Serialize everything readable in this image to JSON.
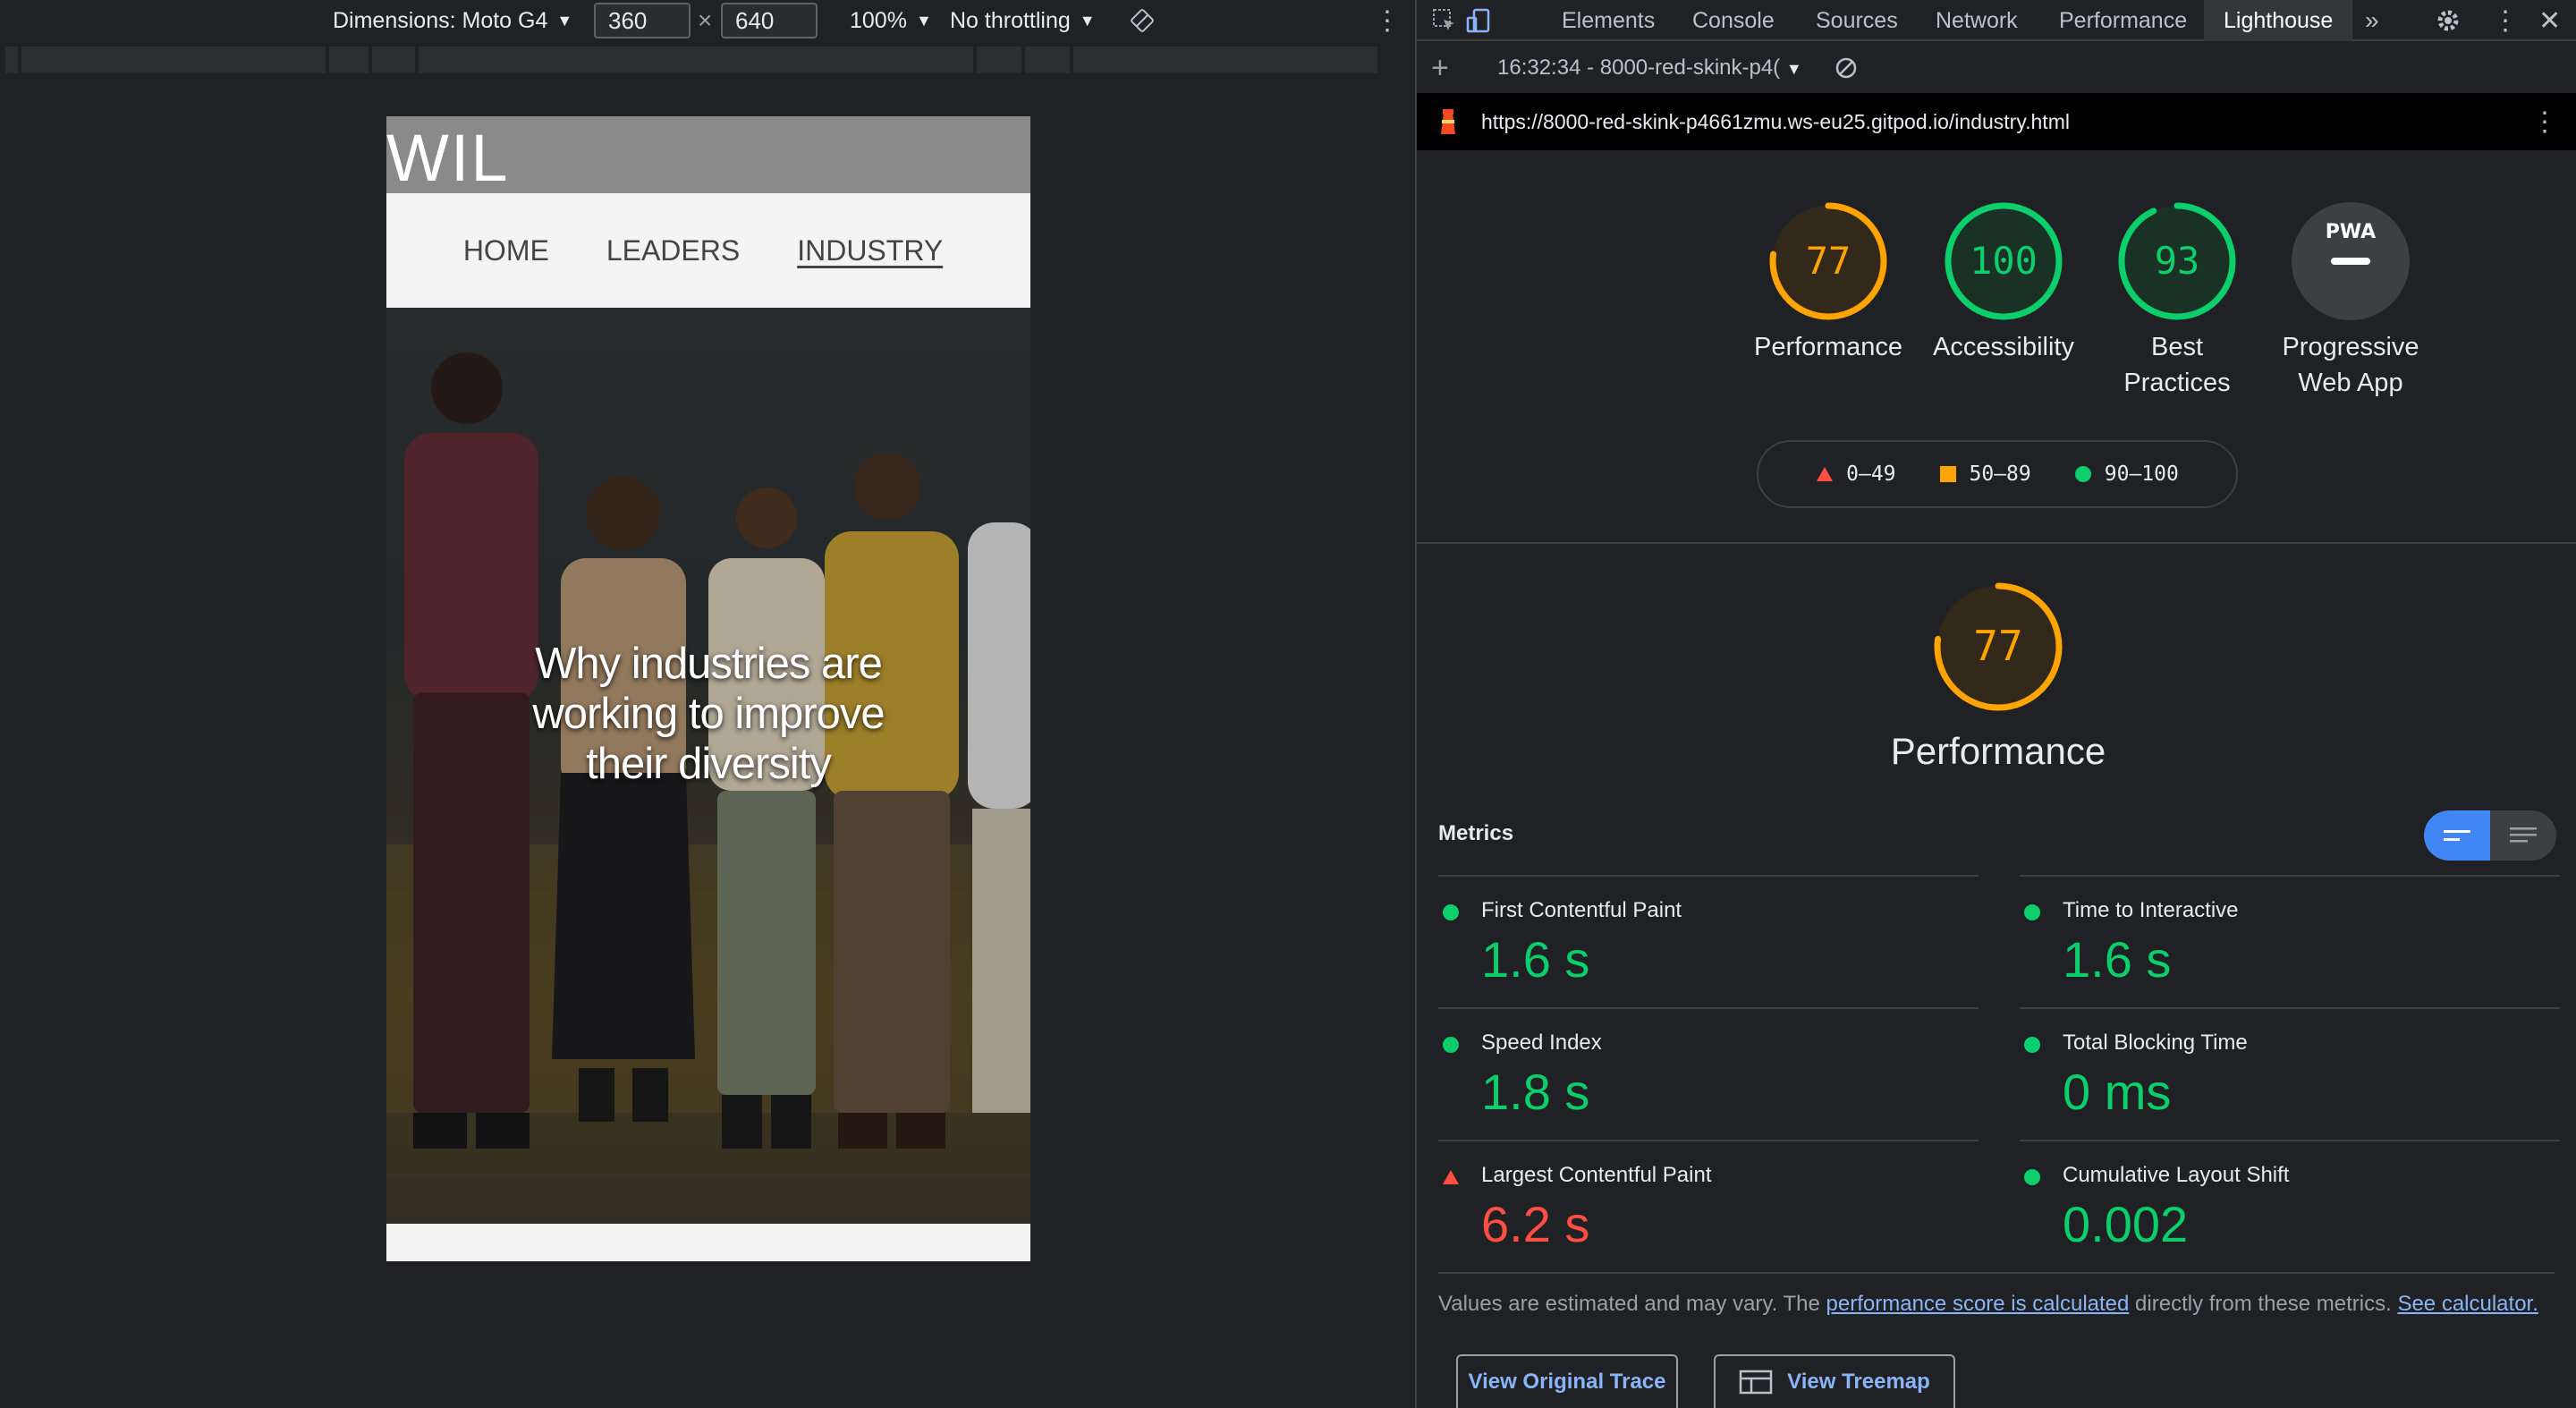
{
  "device_toolbar": {
    "dimensions_label": "Dimensions: Moto G4",
    "width_value": "360",
    "times": "×",
    "height_value": "640",
    "zoom": "100%",
    "throttling": "No throttling"
  },
  "site": {
    "logo": "WIL",
    "nav": [
      "HOME",
      "LEADERS",
      "INDUSTRY"
    ],
    "active_nav": "INDUSTRY",
    "hero_title": "Why industries are working to improve their diversity"
  },
  "devtools": {
    "tabs": [
      "Elements",
      "Console",
      "Sources",
      "Network",
      "Performance",
      "Lighthouse"
    ],
    "active_tab": "Lighthouse",
    "more_tabs": "»",
    "report_selector": "16:32:34 - 8000-red-skink-p4(",
    "url": "https://8000-red-skink-p4661zmu.ws-eu25.gitpod.io/industry.html"
  },
  "scores": [
    {
      "value": 77,
      "label": "Performance",
      "status": "average"
    },
    {
      "value": 100,
      "label": "Accessibility",
      "status": "pass"
    },
    {
      "value": 93,
      "label": "Best Practices",
      "label_line1": "Best",
      "label_line2": "Practices",
      "status": "pass"
    },
    {
      "value": null,
      "label": "Progressive Web App",
      "label_line1": "Progressive",
      "label_line2": "Web App",
      "badge": "PWA",
      "status": "na"
    }
  ],
  "legend": [
    {
      "range": "0–49",
      "shape": "triangle",
      "color": "#ff4e42"
    },
    {
      "range": "50–89",
      "shape": "square",
      "color": "#ffa400"
    },
    {
      "range": "90–100",
      "shape": "circle",
      "color": "#0cce6b"
    }
  ],
  "performance_section": {
    "score": "77",
    "title": "Performance",
    "metrics_title": "Metrics",
    "metrics": [
      {
        "name": "First Contentful Paint",
        "value": "1.6 s",
        "status": "pass"
      },
      {
        "name": "Time to Interactive",
        "value": "1.6 s",
        "status": "pass"
      },
      {
        "name": "Speed Index",
        "value": "1.8 s",
        "status": "pass"
      },
      {
        "name": "Total Blocking Time",
        "value": "0 ms",
        "status": "pass"
      },
      {
        "name": "Largest Contentful Paint",
        "value": "6.2 s",
        "status": "fail"
      },
      {
        "name": "Cumulative Layout Shift",
        "value": "0.002",
        "status": "pass"
      }
    ],
    "note_prefix": "Values are estimated and may vary. The ",
    "note_link1": "performance score is calculated",
    "note_mid": " directly from these metrics. ",
    "note_link2": "See calculator."
  },
  "buttons": {
    "view_trace": "View Original Trace",
    "view_treemap": "View Treemap"
  },
  "colors": {
    "pass": "#0cce6b",
    "average": "#ffa400",
    "fail": "#ff4e42",
    "accent": "#8ab4f8",
    "toggle_on": "#4285f4"
  }
}
